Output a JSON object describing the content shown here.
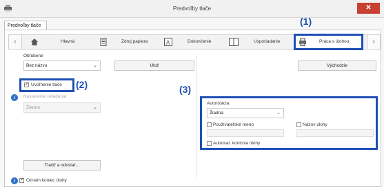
{
  "window": {
    "title": "Predvoľby tlače",
    "close_glyph": "✕"
  },
  "main_tab": {
    "label": "Predvoľby tlače"
  },
  "nav": {
    "prev": "‹",
    "next": "›"
  },
  "tabs": [
    {
      "label": "Hlavná",
      "icon": "home-icon"
    },
    {
      "label": "Zdroj papiera",
      "icon": "paper-tray-icon"
    },
    {
      "label": "Dokončenie",
      "icon": "finishing-icon"
    },
    {
      "label": "Usporiadanie",
      "icon": "layout-icon"
    },
    {
      "label": "Práca s úlohou",
      "icon": "job-handling-icon"
    }
  ],
  "callouts": {
    "one": "(1)",
    "two": "(2)",
    "three": "(3)"
  },
  "favorites": {
    "label": "Obľúbené",
    "value": "Bez názvu",
    "save_label": "Ulož",
    "defaults_label": "Východzie"
  },
  "left": {
    "release_label": "Uvoľnenie tlače",
    "release_checked": true,
    "sub_label": "Nastavenie ukladania",
    "sub_value": "Žiadna",
    "print_send_label": "Tlačiť a odoslať...",
    "notify_label": "Oznám koniec úlohy",
    "notify_checked": true
  },
  "right": {
    "auth_label": "Autorizácia:",
    "auth_value": "Žiadna",
    "username_label": "Používateľské meno",
    "jobname_label": "Názov úlohy",
    "autocheck_label": "Automat. kontrola úlohy"
  },
  "colors": {
    "accent": "#1f4fb5",
    "close": "#c84031",
    "info": "#2e6ec8"
  }
}
